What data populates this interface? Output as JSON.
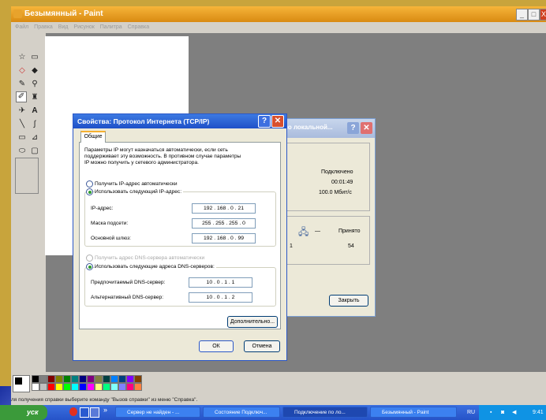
{
  "paint": {
    "title": "Безымянный - Paint",
    "menu": [
      "Файл",
      "Правка",
      "Вид",
      "Рисунок",
      "Палитра",
      "Справка"
    ],
    "status": "ля получения справки выберите команду \"Вызов справки\" из меню \"Справка\"."
  },
  "palette_colors": [
    "#000000",
    "#808080",
    "#800000",
    "#808000",
    "#008000",
    "#008080",
    "#000080",
    "#800080",
    "#808040",
    "#004040",
    "#0080ff",
    "#004080",
    "#8000ff",
    "#804000",
    "#ffffff",
    "#c0c0c0",
    "#ff0000",
    "#ffff00",
    "#00ff00",
    "#00ffff",
    "#0000ff",
    "#ff00ff",
    "#ffff80",
    "#00ff80",
    "#80ffff",
    "#8080ff",
    "#ff0080",
    "#ff8040"
  ],
  "net_window": {
    "title": "по локальной...",
    "status": "Подключено",
    "duration": "00:01:49",
    "speed": "100.0 Мбит/с",
    "received_label": "Принято",
    "received": "54",
    "sent_partial": "1",
    "close_label": "Закрыть"
  },
  "dialog": {
    "title": "Свойства: Протокол Интернета (TCP/IP)",
    "tab": "Общие",
    "intro_lines": [
      "Параметры IP могут назначаться автоматически, если сеть",
      "поддерживает эту возможность. В противном случае параметры",
      "IP можно получить у сетевого администратора."
    ],
    "radio_auto_ip": "Получить IP-адрес автоматически",
    "radio_manual_ip": "Использовать следующий IP-адрес:",
    "ip_label": "IP-адрес:",
    "ip_value": "192 . 168 .  0  .  21",
    "mask_label": "Маска подсети:",
    "mask_value": "255 . 255 . 255 .  0",
    "gateway_label": "Основной шлюз:",
    "gateway_value": "192 . 168 .  0  .  99",
    "radio_auto_dns": "Получить адрес DNS-сервера автоматически",
    "radio_manual_dns": "Использовать следующие адреса DNS-серверов:",
    "dns1_label": "Предпочитаемый DNS-сервер:",
    "dns1_value": "10  .  0  .  1  .  1",
    "dns2_label": "Альтернативный DNS-сервер:",
    "dns2_value": "10  .  0  .  1  .  2",
    "advanced_button": "Дополнительно...",
    "ok_button": "ОК",
    "cancel_button": "Отмена"
  },
  "taskbar": {
    "start_label": "уск",
    "items": [
      "Сервер не найден - ...",
      "Состояние Подключ...",
      "Подключение по ло...",
      "Безымянный - Paint"
    ],
    "lang": "RU",
    "clock": "9:41"
  }
}
